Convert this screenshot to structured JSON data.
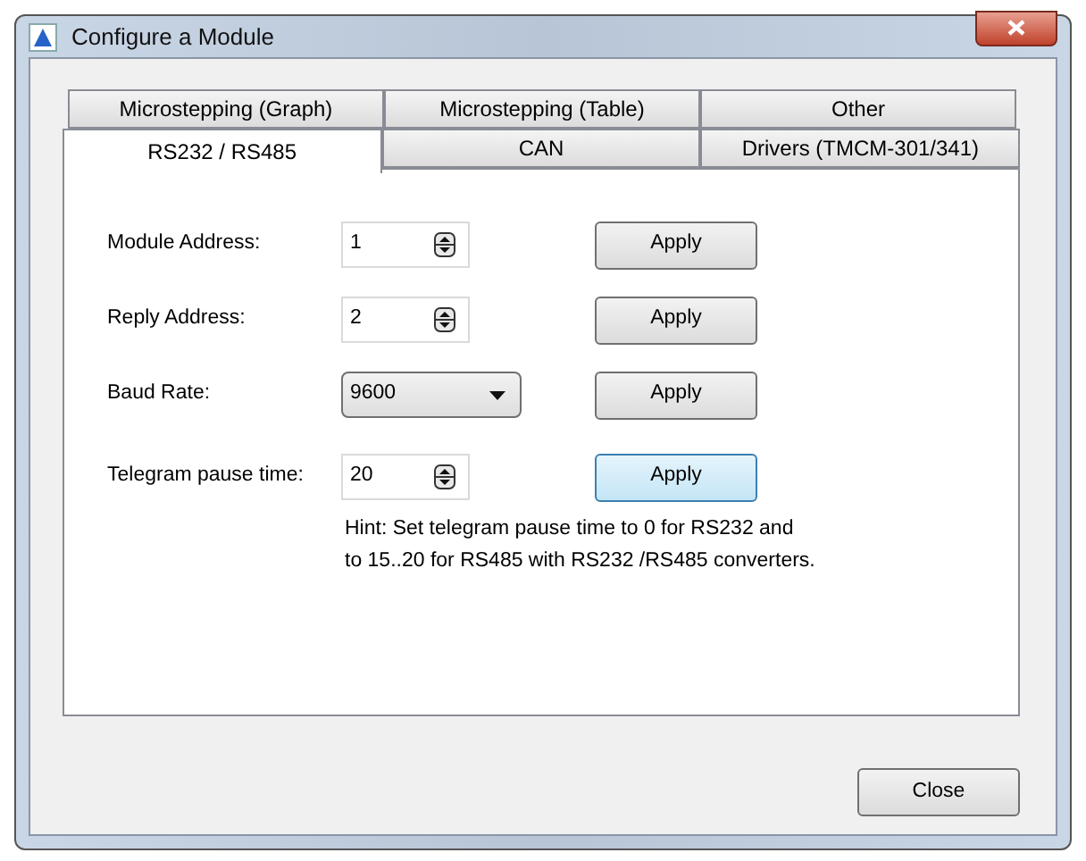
{
  "window": {
    "title": "Configure a Module"
  },
  "tab_rows": [
    [
      {
        "label": "Microstepping (Graph)",
        "selected": false
      },
      {
        "label": "Microstepping (Table)",
        "selected": false
      },
      {
        "label": "Other",
        "selected": false
      }
    ],
    [
      {
        "label": "RS232 / RS485",
        "selected": true
      },
      {
        "label": "CAN",
        "selected": false
      },
      {
        "label": "Drivers (TMCM-301/341)",
        "selected": false
      }
    ]
  ],
  "settings": [
    {
      "label": "Module Address:",
      "kind": "spin",
      "value": "1",
      "button": {
        "label": "Apply",
        "focused": false
      }
    },
    {
      "label": "Reply Address:",
      "kind": "spin",
      "value": "2",
      "button": {
        "label": "Apply",
        "focused": false
      }
    },
    {
      "label": "Baud Rate:",
      "kind": "dropdown",
      "value": "9600",
      "button": {
        "label": "Apply",
        "focused": false
      }
    },
    {
      "label": "Telegram pause time:",
      "kind": "spin",
      "value": "20",
      "button": {
        "label": "Apply",
        "focused": true
      }
    }
  ],
  "hint": [
    "Hint: Set telegram pause time to 0 for RS232 and",
    "to 15..20 for RS485 with RS232 /RS485 converters."
  ],
  "close_button": {
    "label": "Close"
  }
}
